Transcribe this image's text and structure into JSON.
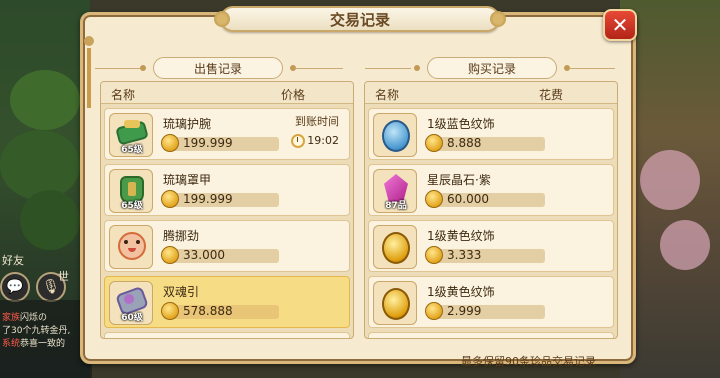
{
  "window": {
    "title": "交易记录",
    "close_glyph": "✕"
  },
  "background_chat": {
    "lines": [
      {
        "tag": "家族",
        "text": "闪烁の"
      },
      {
        "tag": "",
        "text": "了30个九转金丹,"
      },
      {
        "tag": "系统",
        "text": "恭喜一致的 "
      }
    ],
    "buttons": [
      {
        "label": "好友"
      },
      {
        "label": "世"
      }
    ]
  },
  "sell_section": {
    "tab_label": "出售记录",
    "header_name": "名称",
    "header_price": "价格",
    "meta_label": "到账时间",
    "items": [
      {
        "name": "琉璃护腕",
        "level": "65级",
        "price": "199.999",
        "time": "19:02",
        "icon": "bracer-icon"
      },
      {
        "name": "琉璃罩甲",
        "level": "65级",
        "price": "199.999",
        "time": "",
        "icon": "armor-icon"
      },
      {
        "name": "腾挪劲",
        "level": "",
        "price": "33.000",
        "time": "",
        "icon": "pet-skill-icon"
      },
      {
        "name": "双魂引",
        "level": "60级",
        "price": "578.888",
        "time": "",
        "icon": "gloves-icon"
      }
    ]
  },
  "buy_section": {
    "tab_label": "购买记录",
    "header_name": "名称",
    "header_cost": "花费",
    "items": [
      {
        "name": "1级蓝色纹饰",
        "badge": "",
        "price": "8.888",
        "icon": "blue-ornament-icon"
      },
      {
        "name": "星辰晶石·紫",
        "badge": "87品",
        "price": "60.000",
        "icon": "purple-crystal-icon"
      },
      {
        "name": "1级黄色纹饰",
        "badge": "",
        "price": "3.333",
        "icon": "yellow-ornament-icon"
      },
      {
        "name": "1级黄色纹饰",
        "badge": "",
        "price": "2.999",
        "icon": "yellow-ornament-icon"
      }
    ]
  },
  "footer": {
    "note": "最多保留90条珍品交易记录"
  },
  "colors": {
    "panel_bg": "#f6ead0",
    "highlight_row": "#f7dc86",
    "close_red": "#d23a2a",
    "coin_gold": "#e3a620"
  }
}
